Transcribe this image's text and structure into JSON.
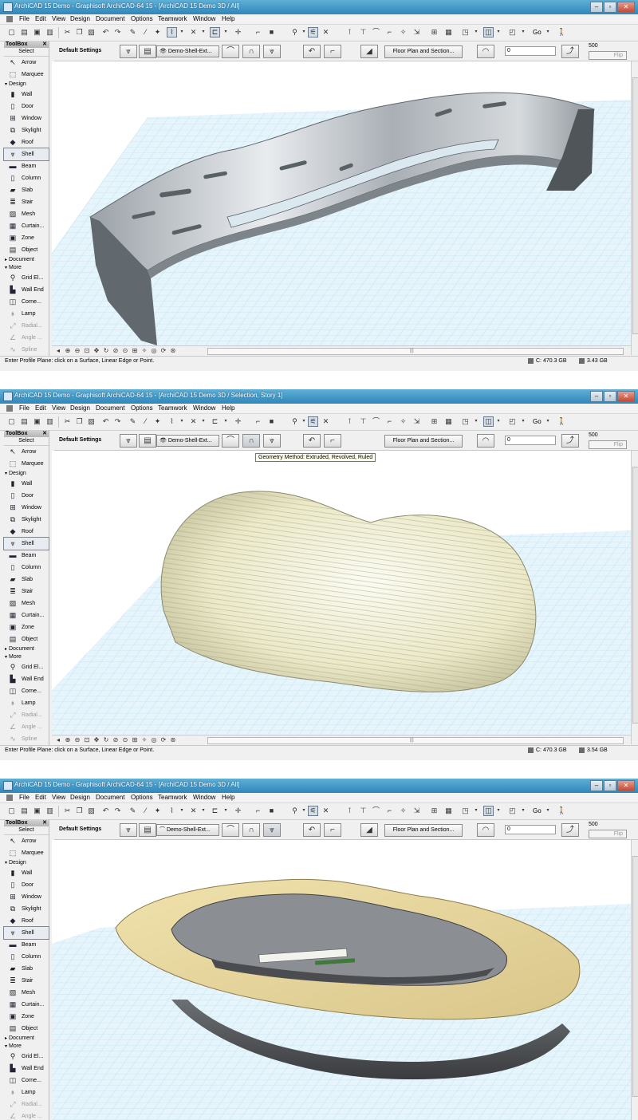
{
  "windows": [
    {
      "title": "ArchiCAD 15 Demo - Graphisoft ArchiCAD-64 15 - [ArchiCAD 15 Demo 3D / All]",
      "layer": "Demo-Shell-Ext...",
      "status_message": "Enter Profile Plane: click on a Surface, Linear Edge or Point.",
      "drive_space": "C: 470.3 GB",
      "memory": "3.43 GB"
    },
    {
      "title": "ArchiCAD 15 Demo - Graphisoft ArchiCAD-64 15 - [ArchiCAD 15 Demo 3D / Selection, Story 1]",
      "layer": "Demo-Shell-Ext...",
      "status_message": "Enter Profile Plane: click on a Surface, Linear Edge or Point.",
      "drive_space": "C: 470.3 GB",
      "memory": "3.54 GB",
      "tooltip": "Geometry Method: Extruded, Revolved, Ruled"
    },
    {
      "title": "ArchiCAD 15 Demo - Graphisoft ArchiCAD-64 15 - [ArchiCAD 15 Demo 3D / All]",
      "layer": "Demo-Shell-Ext...",
      "status_message": "",
      "drive_space": "",
      "memory": ""
    }
  ],
  "menu": [
    "File",
    "Edit",
    "View",
    "Design",
    "Document",
    "Options",
    "Teamwork",
    "Window",
    "Help"
  ],
  "toolbar": {
    "go_label": "Go"
  },
  "infobox": {
    "default_settings": "Default Settings",
    "floor_plan_button": "Floor Plan and Section...",
    "value": "0",
    "value_500": "500",
    "flip": "Flip"
  },
  "toolbox": {
    "title": "ToolBox",
    "select": "Select",
    "arrow": "Arrow",
    "marquee": "Marquee",
    "design_group": "Design",
    "design_tools": [
      {
        "label": "Wall",
        "icon": "wall-icon"
      },
      {
        "label": "Door",
        "icon": "door-icon"
      },
      {
        "label": "Window",
        "icon": "window-icon"
      },
      {
        "label": "Skylight",
        "icon": "skylight-icon"
      },
      {
        "label": "Roof",
        "icon": "roof-icon"
      },
      {
        "label": "Shell",
        "icon": "shell-icon"
      },
      {
        "label": "Beam",
        "icon": "beam-icon"
      },
      {
        "label": "Column",
        "icon": "column-icon"
      },
      {
        "label": "Slab",
        "icon": "slab-icon"
      },
      {
        "label": "Stair",
        "icon": "stair-icon"
      },
      {
        "label": "Mesh",
        "icon": "mesh-icon"
      },
      {
        "label": "Curtain...",
        "icon": "curtain-wall-icon"
      },
      {
        "label": "Zone",
        "icon": "zone-icon"
      },
      {
        "label": "Object",
        "icon": "object-icon"
      }
    ],
    "document_group": "Document",
    "more_group": "More",
    "more_tools": [
      {
        "label": "Grid El...",
        "icon": "grid-element-icon"
      },
      {
        "label": "Wall End",
        "icon": "wall-end-icon"
      },
      {
        "label": "Corne...",
        "icon": "corner-window-icon"
      },
      {
        "label": "Lamp",
        "icon": "lamp-icon"
      },
      {
        "label": "Radial...",
        "icon": "radial-dimension-icon"
      },
      {
        "label": "Angle ...",
        "icon": "angle-dimension-icon"
      },
      {
        "label": "Spline",
        "icon": "spline-icon"
      }
    ]
  },
  "colors": {
    "title_bar": "#2f86b9",
    "grid_line": "#bfe0ee",
    "grid_fill": "#e4f3fa",
    "shell_gray": "#a8aeb3",
    "dome_cream": "#efecd0",
    "rim_tan": "#e6d49a",
    "bowl_dark": "#4c4e52"
  }
}
